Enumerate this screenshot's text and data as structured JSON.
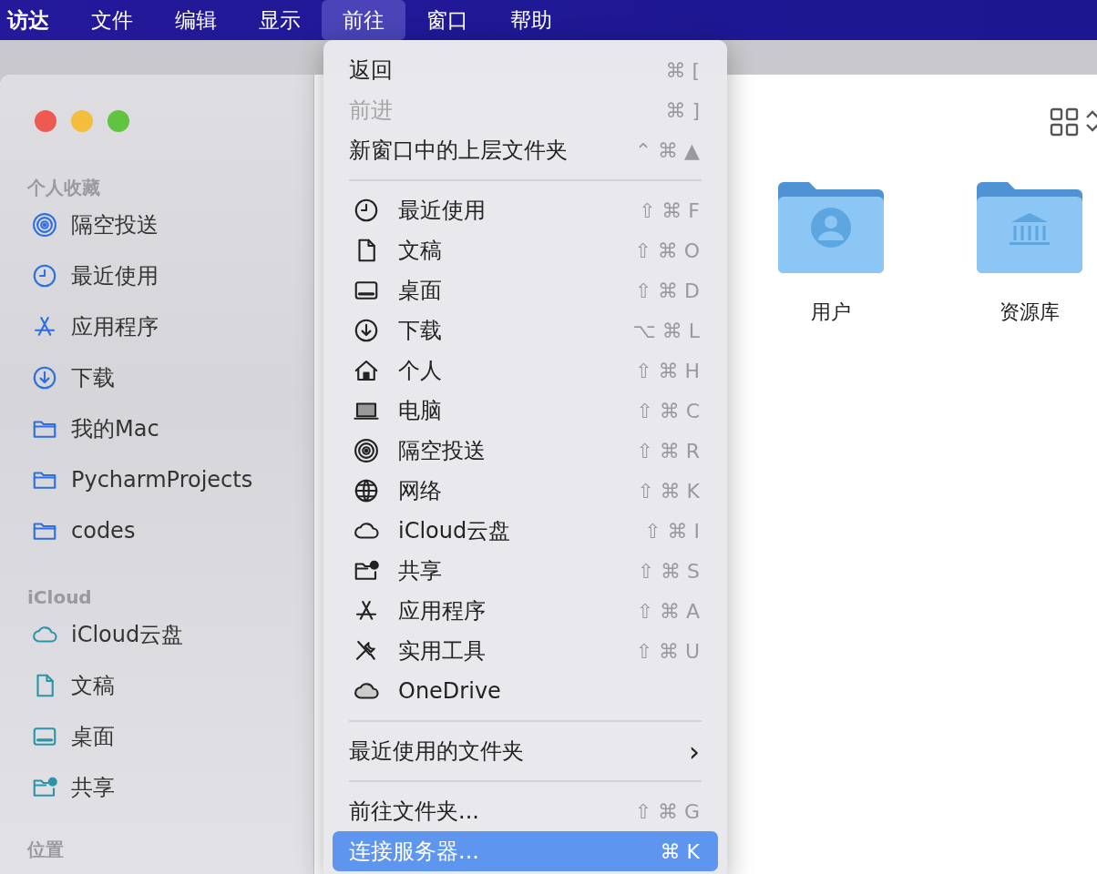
{
  "menu_bar": {
    "items": [
      {
        "label": "访达",
        "selected": false
      },
      {
        "label": "文件",
        "selected": false
      },
      {
        "label": "编辑",
        "selected": false
      },
      {
        "label": "显示",
        "selected": false
      },
      {
        "label": "前往",
        "selected": true
      },
      {
        "label": "窗口",
        "selected": false
      },
      {
        "label": "帮助",
        "selected": false
      }
    ]
  },
  "sidebar": {
    "sections": [
      {
        "heading": "个人收藏",
        "items": [
          {
            "label": "隔空投送"
          },
          {
            "label": "最近使用"
          },
          {
            "label": "应用程序"
          },
          {
            "label": "下载"
          },
          {
            "label": "我的Mac"
          },
          {
            "label": "PycharmProjects"
          },
          {
            "label": "codes"
          }
        ]
      },
      {
        "heading": "iCloud",
        "items": [
          {
            "label": "iCloud云盘"
          },
          {
            "label": "文稿"
          },
          {
            "label": "桌面"
          },
          {
            "label": "共享"
          }
        ]
      },
      {
        "heading": "位置"
      }
    ]
  },
  "content": {
    "folders": [
      {
        "label": "用户"
      },
      {
        "label": "资源库"
      }
    ]
  },
  "go_menu": {
    "groups": [
      {
        "kind": "plain",
        "items": [
          {
            "label": "返回",
            "shortcut": "⌘ [",
            "disabled": false,
            "selected": false
          },
          {
            "label": "前进",
            "shortcut": "⌘ ]",
            "disabled": true,
            "selected": false
          },
          {
            "label": "新窗口中的上层文件夹",
            "shortcut": "⌃ ⌘ ▲",
            "disabled": false,
            "selected": false
          }
        ]
      },
      {
        "kind": "places",
        "items": [
          {
            "label": "最近使用",
            "shortcut": "⇧ ⌘ F",
            "disabled": false,
            "selected": false
          },
          {
            "label": "文稿",
            "shortcut": "⇧ ⌘ O",
            "disabled": false,
            "selected": false
          },
          {
            "label": "桌面",
            "shortcut": "⇧ ⌘ D",
            "disabled": false,
            "selected": false
          },
          {
            "label": "下载",
            "shortcut": "⌥ ⌘ L",
            "disabled": false,
            "selected": false
          },
          {
            "label": "个人",
            "shortcut": "⇧ ⌘ H",
            "disabled": false,
            "selected": false
          },
          {
            "label": "电脑",
            "shortcut": "⇧ ⌘ C",
            "disabled": false,
            "selected": false
          },
          {
            "label": "隔空投送",
            "shortcut": "⇧ ⌘ R",
            "disabled": false,
            "selected": false
          },
          {
            "label": "网络",
            "shortcut": "⇧ ⌘ K",
            "disabled": false,
            "selected": false
          },
          {
            "label": "iCloud云盘",
            "shortcut": "⇧ ⌘ I",
            "disabled": false,
            "selected": false
          },
          {
            "label": "共享",
            "shortcut": "⇧ ⌘ S",
            "disabled": false,
            "selected": false
          },
          {
            "label": "应用程序",
            "shortcut": "⇧ ⌘ A",
            "disabled": false,
            "selected": false
          },
          {
            "label": "实用工具",
            "shortcut": "⇧ ⌘ U",
            "disabled": false,
            "selected": false
          },
          {
            "label": "OneDrive",
            "disabled": false,
            "selected": false
          }
        ]
      },
      {
        "kind": "submenu",
        "items": [
          {
            "label": "最近使用的文件夹",
            "submenu_arrow": "›",
            "disabled": false,
            "selected": false
          }
        ]
      },
      {
        "kind": "plain",
        "items": [
          {
            "label": "前往文件夹...",
            "shortcut": "⇧ ⌘ G",
            "disabled": false,
            "selected": false
          },
          {
            "label": "连接服务器...",
            "shortcut": "⌘ K",
            "disabled": false,
            "selected": true
          }
        ]
      }
    ]
  }
}
